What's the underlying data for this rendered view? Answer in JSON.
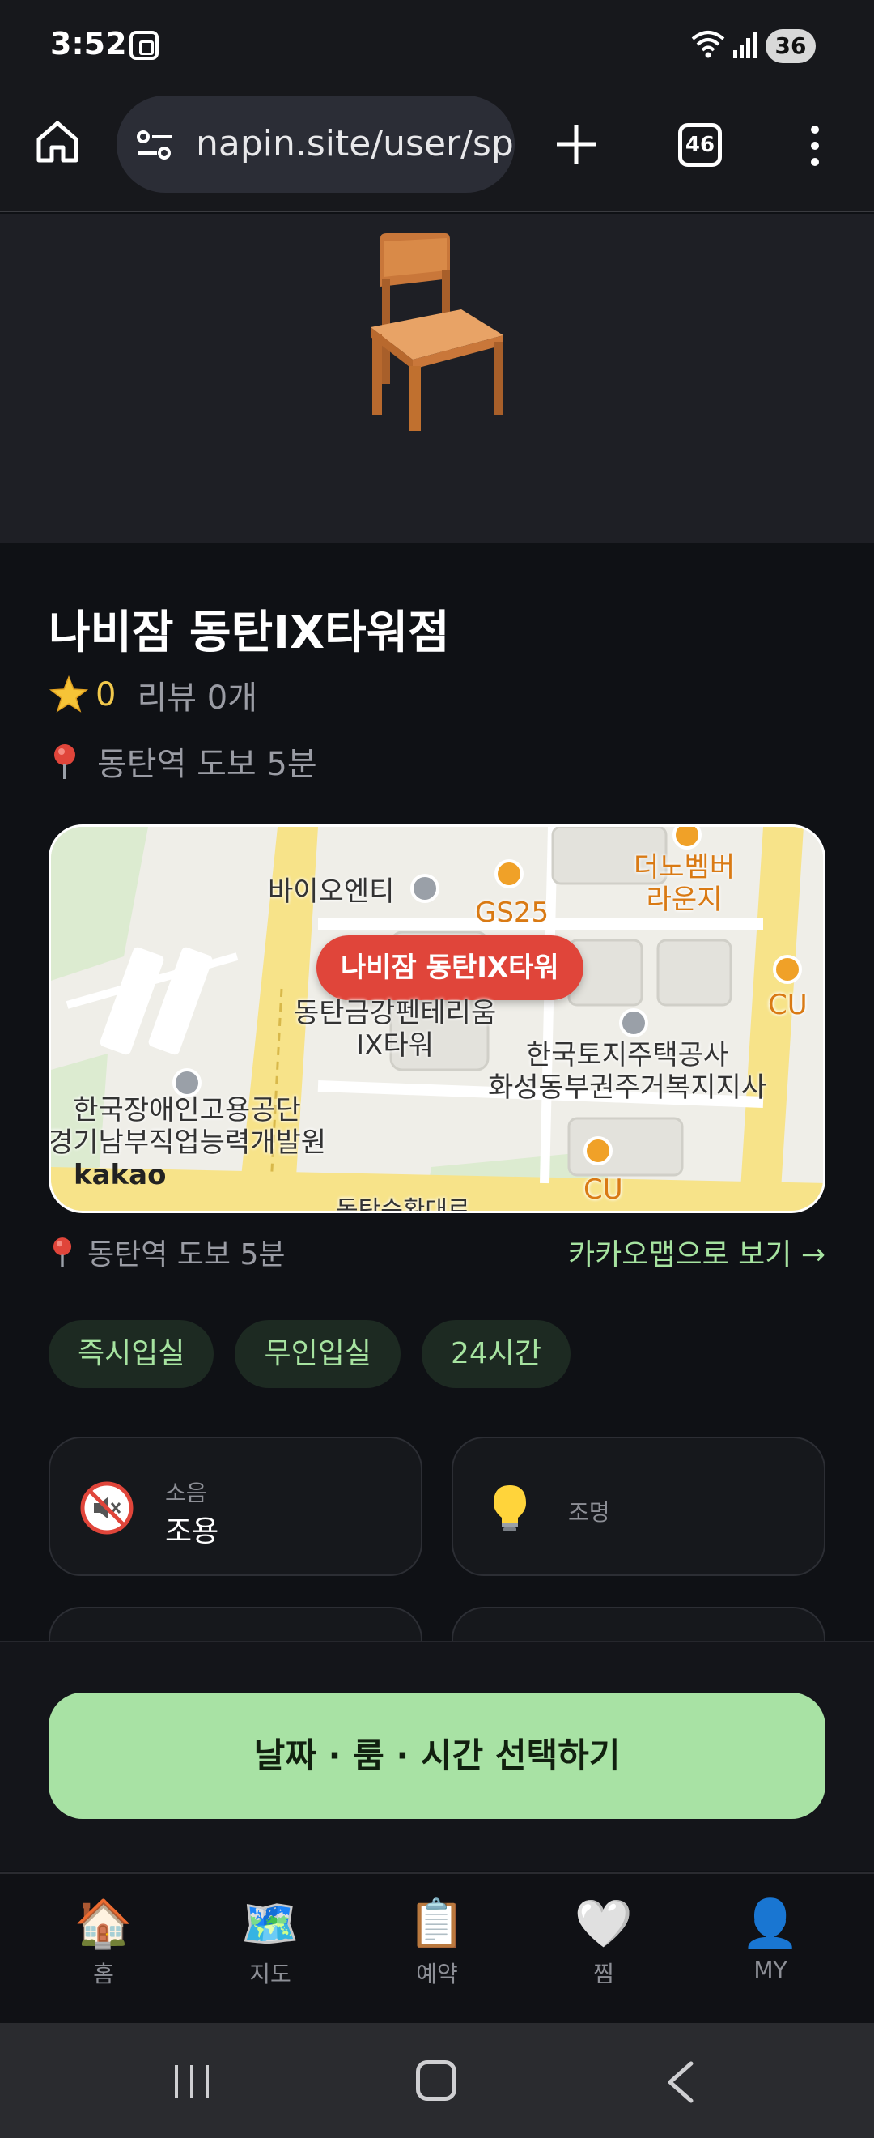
{
  "status_bar": {
    "time": "3:52",
    "battery": "36"
  },
  "browser": {
    "url": "napin.site/user/sp",
    "tab_count": "46"
  },
  "place": {
    "title": "나비잠 동탄IX타워점",
    "rating": "0",
    "review_text": "리뷰 0개",
    "location_text": "동탄역 도보 5분"
  },
  "map": {
    "pin_label": "나비잠 동탄IX타워",
    "labels": {
      "bioenti": "바이오엔티",
      "gs25": "GS25",
      "lounge": "더노벰버\n라운지",
      "cu_right": "CU",
      "pentaerium": "동탄금강펜테리움\nIX타워",
      "lh": "한국토지주택공사\n화성동부권주거복지지사",
      "kead": "한국장애인고용공단\n경기남부직업능력개발원",
      "cu_bottom": "CU",
      "road": "동탄순환대로"
    },
    "provider": "kakao"
  },
  "map_footer": {
    "location_text": "동탄역 도보 5분",
    "kakao_link": "카카오맵으로 보기 →"
  },
  "tags": [
    "즉시입실",
    "무인입실",
    "24시간"
  ],
  "features": {
    "noise": {
      "label": "소음",
      "value": "조용",
      "icon": "muted-speaker-icon"
    },
    "light": {
      "label": "조명",
      "icon": "light-bulb-icon"
    }
  },
  "cta": {
    "label": "날짜 · 룸 · 시간 선택하기"
  },
  "bottom_nav": [
    {
      "label": "홈",
      "icon": "🏠"
    },
    {
      "label": "지도",
      "icon": "🗺️"
    },
    {
      "label": "예약",
      "icon": "📋"
    },
    {
      "label": "찜",
      "icon": "🤍"
    },
    {
      "label": "MY",
      "icon": "👤"
    }
  ],
  "colors": {
    "accent_green": "#a8e2a4",
    "rating_yellow": "#f2c94c",
    "map_pin_red": "#e0453a"
  }
}
